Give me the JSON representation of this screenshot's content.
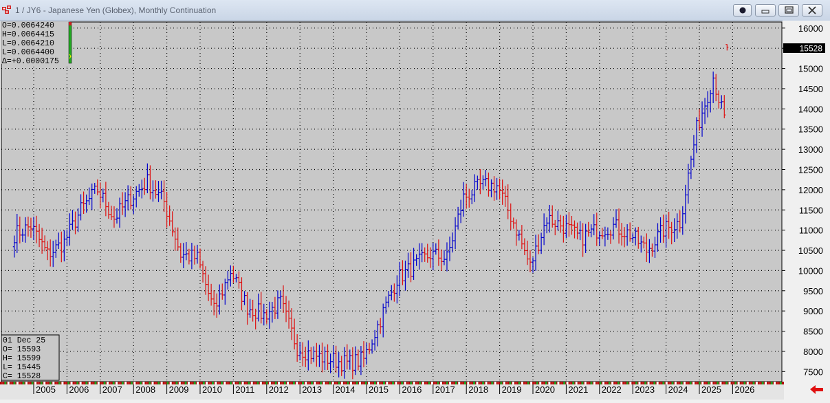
{
  "window": {
    "title": "1 / JY6 - Japanese Yen (Globex), Monthly Continuation",
    "buttons": [
      "record-icon",
      "minimize-icon",
      "restore-icon",
      "close-icon"
    ]
  },
  "ohlc_top": {
    "o": "O=0.0064240",
    "h": "H=0.0064415",
    "l1": "L=0.0064210",
    "l2": "L=0.0064400",
    "delta": "Δ=+0.0000175"
  },
  "ohlc_bottom": {
    "date": "01  Dec  25",
    "o": "O=    15593",
    "h": "H=    15599",
    "l": "L=    15445",
    "c": "C=    15528"
  },
  "last_price_label": "15528",
  "colors": {
    "up": "#0000cc",
    "down": "#dd1111",
    "plot_bg": "#c8c8c8",
    "grid": "#000000",
    "arrow": "#e01010"
  },
  "chart_data": {
    "type": "ohlc",
    "title": "1 / JY6 - Japanese Yen (Globex), Monthly Continuation",
    "x_labels": [
      "2005",
      "2006",
      "2007",
      "2008",
      "2009",
      "2010",
      "2011",
      "2012",
      "2013",
      "2014",
      "2015",
      "2016",
      "2017",
      "2018",
      "2019",
      "2020",
      "2021",
      "2022",
      "2023",
      "2024",
      "2025",
      "2026"
    ],
    "y_ticks": [
      7500,
      8000,
      8500,
      9000,
      9500,
      10000,
      10500,
      11000,
      11500,
      12000,
      12500,
      13000,
      13500,
      14000,
      14500,
      15000,
      15500,
      16000
    ],
    "ylim": [
      7250,
      16150
    ],
    "start": "2004-06",
    "end": "2025-12",
    "yearly_close_path": [
      10900,
      11100,
      10400,
      10700,
      11500,
      12000,
      11300,
      11800,
      12200,
      11700,
      10400,
      10300,
      9000,
      10000,
      9100,
      8900,
      9200,
      8100,
      7900,
      7800,
      7700,
      7800,
      8800,
      9800,
      10100,
      10400,
      10300,
      11800,
      12100,
      12100,
      11200,
      10100,
      11300,
      11100,
      10800,
      11000,
      11100,
      10900,
      10500,
      11000,
      11200,
      13500,
      14800,
      13200,
      14500,
      15200,
      14200,
      15600,
      14500,
      14600,
      15528
    ],
    "last": {
      "date": "01 Dec 25",
      "open": 15593,
      "high": 15599,
      "low": 15445,
      "close": 15528
    },
    "grid": true
  }
}
